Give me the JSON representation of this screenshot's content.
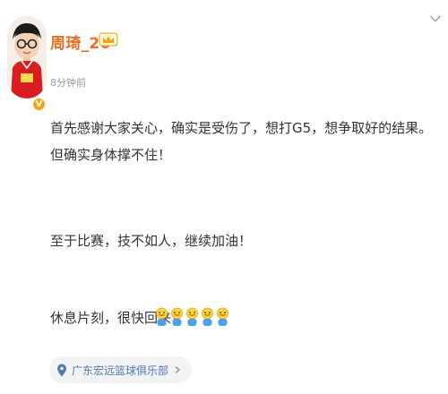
{
  "post": {
    "author": {
      "name": "周琦_26"
    },
    "timestamp": "8分钟前",
    "paragraphs": [
      "首先感谢大家关心，确实是受伤了，想打G5，想争取好的结果。但确实身体撑不住！",
      "至于比赛，技不如人，继续加油！",
      "休息片刻，很快回来！"
    ],
    "emoji_count": 5,
    "location": {
      "name": "广东宏远篮球俱乐部"
    }
  },
  "colors": {
    "username": "#f26b1d",
    "badge": "#f7a40f",
    "location_text": "#4f79b3",
    "location_bg": "#f3f3f3",
    "timestamp": "#9a9a9a"
  },
  "icons": {
    "menu": "chevron-down-icon",
    "member": "crown-icon",
    "verified": "verified-badge-icon",
    "location": "location-pin-icon",
    "location_more": "chevron-right-icon",
    "emoji": "smiling-face-icon"
  }
}
